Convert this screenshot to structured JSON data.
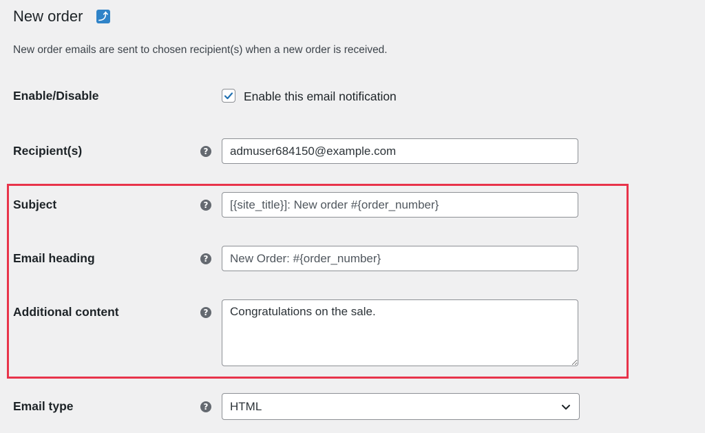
{
  "header": {
    "title": "New order",
    "back_icon": "return-arrow-icon",
    "description": "New order emails are sent to chosen recipient(s) when a new order is received."
  },
  "fields": {
    "enable": {
      "label": "Enable/Disable",
      "checkbox_label": "Enable this email notification",
      "checked": true
    },
    "recipient": {
      "label": "Recipient(s)",
      "value": "admuser684150@example.com"
    },
    "subject": {
      "label": "Subject",
      "placeholder": "[{site_title}]: New order #{order_number}"
    },
    "heading": {
      "label": "Email heading",
      "placeholder": "New Order: #{order_number}"
    },
    "additional": {
      "label": "Additional content",
      "value": "Congratulations on the sale."
    },
    "email_type": {
      "label": "Email type",
      "selected": "HTML"
    }
  },
  "icons": {
    "help": "?",
    "chevron": "chevron-down-icon"
  },
  "colors": {
    "highlight": "#e8334a",
    "accent": "#2271b1",
    "background": "#f0f0f1"
  }
}
